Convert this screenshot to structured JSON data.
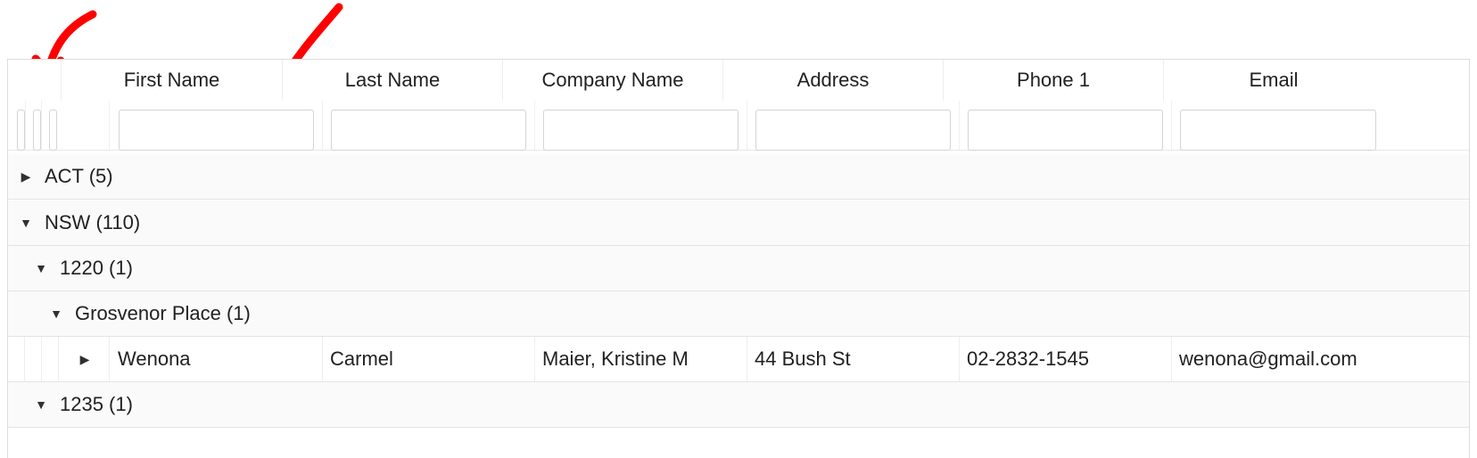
{
  "columns": {
    "first_name": "First Name",
    "last_name": "Last Name",
    "company_name": "Company Name",
    "address": "Address",
    "phone1": "Phone 1",
    "email": "Email"
  },
  "filter_placeholders": {
    "first_name": "",
    "last_name": "",
    "company_name": "",
    "address": "",
    "phone1": "",
    "email": ""
  },
  "groups": {
    "act": "ACT (5)",
    "nsw": "NSW (110)",
    "postcode_1220": "1220 (1)",
    "grosvenor_place": "Grosvenor Place (1)",
    "postcode_1235": "1235 (1)"
  },
  "data_row": {
    "first_name": "Wenona",
    "last_name": "Carmel",
    "company_name": "Maier, Kristine M",
    "address": "44 Bush St",
    "phone1": "02-2832-1545",
    "email": "wenona@gmail.com"
  },
  "icons": {
    "expanded": "caret-down-icon",
    "collapsed": "caret-right-icon",
    "annotation": "red-arrow-annotation"
  },
  "colors": {
    "annotation": "#ff0000",
    "border": "#dcdcdc"
  }
}
